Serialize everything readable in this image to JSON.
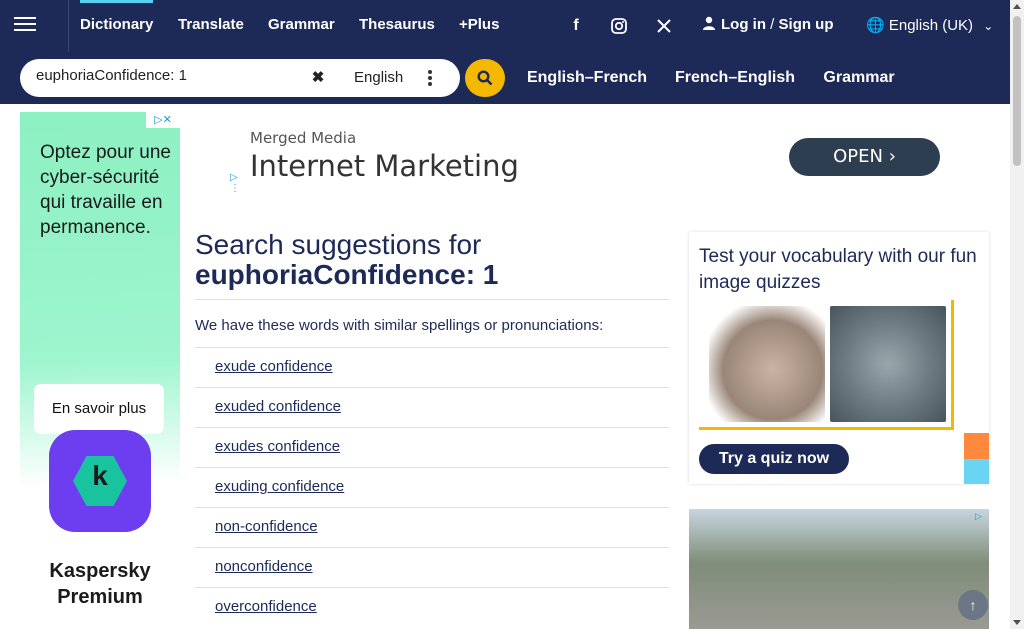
{
  "nav": {
    "items": [
      {
        "label": "Dictionary",
        "active": true
      },
      {
        "label": "Translate"
      },
      {
        "label": "Grammar"
      },
      {
        "label": "Thesaurus"
      },
      {
        "label": "+Plus"
      }
    ],
    "social": [
      "facebook-icon",
      "instagram-icon",
      "x-icon"
    ],
    "login_label": "Log in",
    "login_sep": "/",
    "signup_label": "Sign up",
    "language": "English (UK)",
    "accent_color": "#5ad0f0",
    "bg_color": "#1d2a57"
  },
  "search": {
    "value": "euphoriaConfidence: 1",
    "dictionary_select": "English",
    "button_color": "#f5b800"
  },
  "dict_links": [
    "English–French",
    "French–English",
    "Grammar"
  ],
  "left_ad": {
    "headline": "Optez pour une cyber-sécurité qui travaille en permanence.",
    "cta": "En savoir plus",
    "logo_letter": "k",
    "brand": "Kaspersky Premium"
  },
  "banner_ad": {
    "advertiser": "Merged Media",
    "headline": "Internet Marketing",
    "cta": "OPEN ›"
  },
  "main": {
    "title_prefix": "Search suggestions for",
    "title_term": "euphoriaConfidence: 1",
    "intro": "We have these words with similar spellings or pronunciations:",
    "suggestions": [
      "exude confidence",
      "exuded confidence",
      "exudes confidence",
      "exuding confidence",
      "non-confidence",
      "nonconfidence",
      "overconfidence"
    ]
  },
  "quiz": {
    "title": "Test your vocabulary with our fun image quizzes",
    "images": [
      "hippo",
      "seal"
    ],
    "cta": "Try a quiz now"
  }
}
